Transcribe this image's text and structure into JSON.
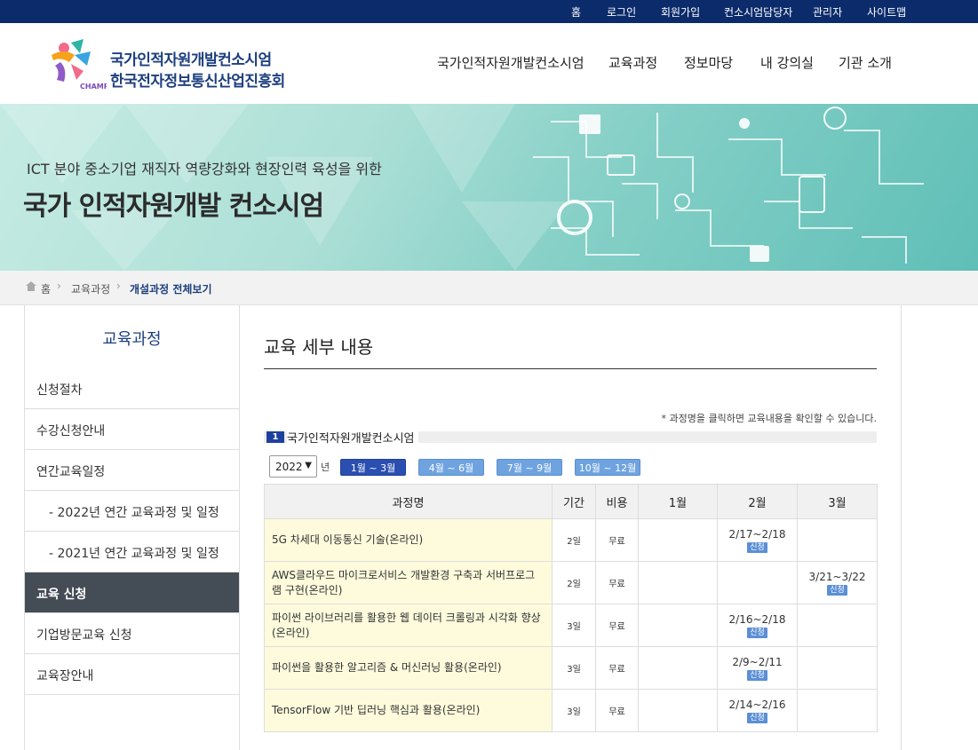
{
  "topbar": {
    "links": [
      "홈",
      "로그인",
      "회원가입",
      "컨소시엄담당자",
      "관리자",
      "사이트맵"
    ]
  },
  "header": {
    "logo_line1": "국가인적자원개발컨소시엄",
    "logo_line2": "한국전자정보통신산업진흥회",
    "logo_mark_text": "CHAMP",
    "nav": [
      "국가인적자원개발컨소시엄",
      "교육과정",
      "정보마당",
      "내 강의실",
      "기관 소개"
    ]
  },
  "banner": {
    "subtitle": "ICT 분야 중소기업 재직자 역량강화와 현장인력 육성을 위한",
    "title": "국가 인적자원개발 컨소시엄"
  },
  "breadcrumb": [
    "홈",
    "교육과정",
    "개설과정 전체보기"
  ],
  "sidebar": {
    "title": "교육과정",
    "items": [
      "신청절차",
      "수강신청안내",
      "연간교육일정",
      "- 2022년 연간 교육과정 및 일정",
      "- 2021년 연간 교육과정 및 일정",
      "교육 신청",
      "기업방문교육 신청",
      "교육장안내"
    ],
    "active": "교육 신청"
  },
  "content": {
    "title": "교육 세부 내용",
    "note": "* 과정명을 클릭하면 교육내용을 확인할 수 있습니다.",
    "section_num": "1",
    "section_name": "국가인적자원개발컨소시엄",
    "year": "2022",
    "year_label": "년",
    "quarters": [
      "1월 ~ 3월",
      "4월 ~ 6월",
      "7월 ~ 9월",
      "10월 ~ 12월"
    ],
    "active_quarter": "1월 ~ 3월"
  },
  "table": {
    "headers": [
      "과정명",
      "기간",
      "비용",
      "1월",
      "2월",
      "3월"
    ],
    "apply_label": "신청",
    "rows": [
      {
        "name": "5G 차세대 이동통신 기술(온라인)",
        "period": "2일",
        "cost": "무료",
        "jan": "",
        "feb": "2/17~2/18",
        "mar": ""
      },
      {
        "name": "AWS클라우드 마이크로서비스 개발환경 구축과 서버프로그램 구현(온라인)",
        "period": "2일",
        "cost": "무료",
        "jan": "",
        "feb": "",
        "mar": "3/21~3/22"
      },
      {
        "name": "파이썬 라이브러리를 활용한 웹 데이터 크롤링과 시각화 향상(온라인)",
        "period": "3일",
        "cost": "무료",
        "jan": "",
        "feb": "2/16~2/18",
        "mar": ""
      },
      {
        "name": "파이썬을 활용한 알고리즘 & 머신러닝 활용(온라인)",
        "period": "3일",
        "cost": "무료",
        "jan": "",
        "feb": "2/9~2/11",
        "mar": ""
      },
      {
        "name": "TensorFlow 기반 딥러닝 핵심과 활용(온라인)",
        "period": "3일",
        "cost": "무료",
        "jan": "",
        "feb": "2/14~2/16",
        "mar": ""
      }
    ]
  },
  "colors": {
    "topbar": "#0b2b6b",
    "brand": "#1d3f7e",
    "active_nav": "#444c55",
    "apply_badge": "#5b8fd6"
  }
}
